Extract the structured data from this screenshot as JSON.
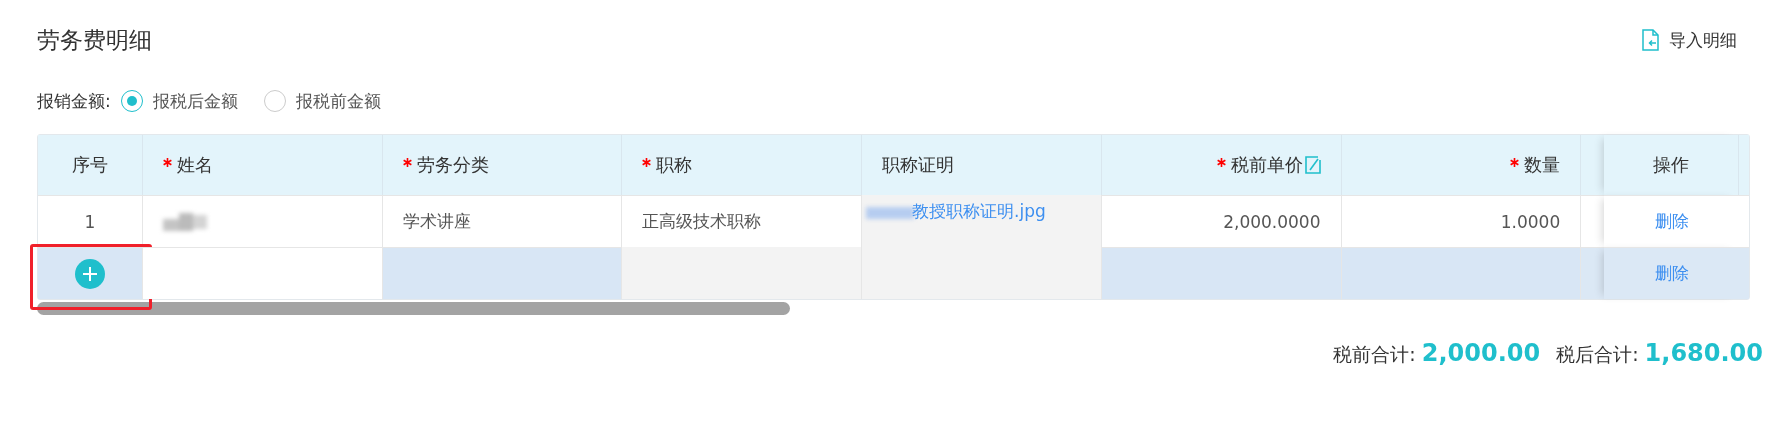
{
  "title": "劳务费明细",
  "import_button": {
    "label": "导入明细"
  },
  "reimburse": {
    "label": "报销金额:",
    "options": [
      {
        "label": "报税后金额",
        "selected": true
      },
      {
        "label": "报税前金额",
        "selected": false
      }
    ]
  },
  "table": {
    "columns": [
      {
        "label": "序号",
        "required": false,
        "editable_icon": false
      },
      {
        "label": "姓名",
        "required": true,
        "editable_icon": false
      },
      {
        "label": "劳务分类",
        "required": true,
        "editable_icon": false
      },
      {
        "label": "职称",
        "required": true,
        "editable_icon": false
      },
      {
        "label": "职称证明",
        "required": false,
        "editable_icon": false
      },
      {
        "label": "税前单价",
        "required": true,
        "editable_icon": true
      },
      {
        "label": "数量",
        "required": true,
        "editable_icon": false
      }
    ],
    "action_column": "操作",
    "rows": [
      {
        "editing": false,
        "cells": [
          {
            "kind": "text",
            "text": "1",
            "disabled": false
          },
          {
            "kind": "blurred",
            "disabled": false
          },
          {
            "kind": "text",
            "text": "学术讲座",
            "disabled": false
          },
          {
            "kind": "text",
            "text": "正高级技术职称",
            "disabled": false
          },
          {
            "kind": "link",
            "text": "教授职称证明.jpg",
            "disabled": true
          },
          {
            "kind": "text",
            "text": "2,000.0000",
            "disabled": false
          },
          {
            "kind": "text",
            "text": "1.0000",
            "disabled": false
          }
        ],
        "action": "删除"
      },
      {
        "editing": true,
        "cells": [
          {
            "kind": "add",
            "highlighted": true,
            "disabled": false
          },
          {
            "kind": "input",
            "disabled": false
          },
          {
            "kind": "empty",
            "disabled": false
          },
          {
            "kind": "empty",
            "disabled": true
          },
          {
            "kind": "empty",
            "disabled": true
          },
          {
            "kind": "empty",
            "disabled": false
          },
          {
            "kind": "empty",
            "disabled": false
          }
        ],
        "action": "删除"
      }
    ]
  },
  "totals": [
    {
      "label": "税前合计:",
      "value": "2,000.00"
    },
    {
      "label": "税后合计:",
      "value": "1,680.00"
    }
  ]
}
